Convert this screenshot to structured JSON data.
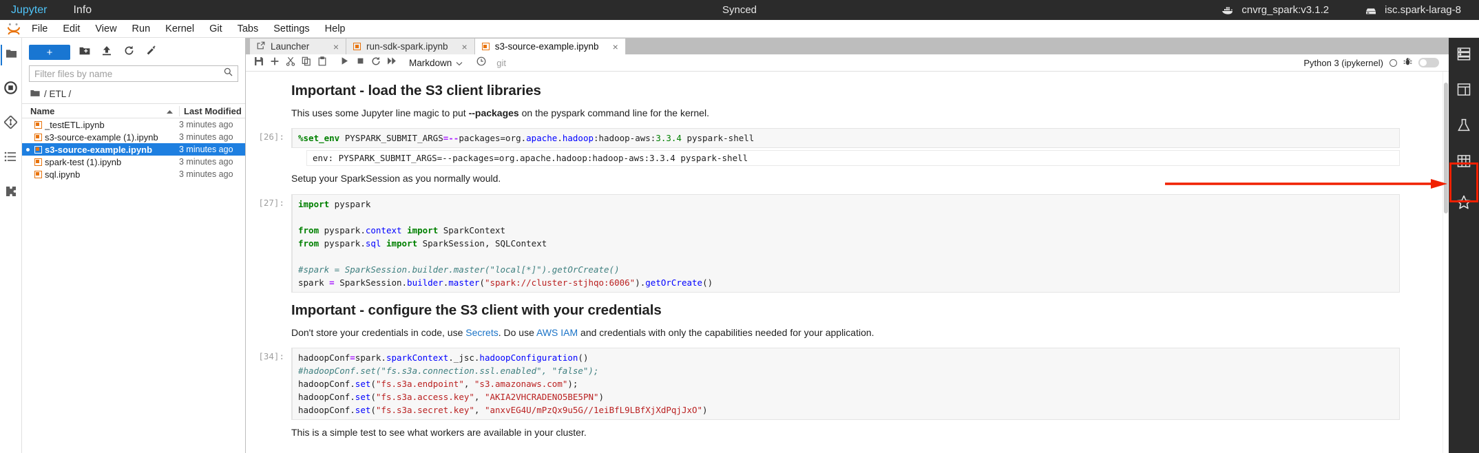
{
  "topbar": {
    "brand": "Jupyter",
    "info": "Info",
    "status": "Synced",
    "docker_icon": "docker-whale-icon",
    "docker_label": "cnvrg_spark:v3.1.2",
    "server_icon": "server-icon",
    "server_label": "isc.spark-larag-8",
    "accent": "#4fc3f7",
    "bg": "#2b2b2b"
  },
  "menubar": {
    "logo": "jupyter-logo",
    "items": [
      "File",
      "Edit",
      "View",
      "Run",
      "Kernel",
      "Git",
      "Tabs",
      "Settings",
      "Help"
    ]
  },
  "left_rail": {
    "items": [
      {
        "icon": "folder-icon",
        "name": "file-browser"
      },
      {
        "icon": "running-terminals-icon",
        "name": "running"
      },
      {
        "icon": "git-icon",
        "name": "git-panel"
      },
      {
        "icon": "table-of-contents-icon",
        "name": "toc"
      },
      {
        "icon": "extensions-puzzle-icon",
        "name": "extensions"
      }
    ]
  },
  "filebrowser": {
    "new_button": "+",
    "toolbar_icons": [
      "new-folder-icon",
      "upload-icon",
      "refresh-icon",
      "new-launcher-icon"
    ],
    "filter_placeholder": "Filter files by name",
    "filter_value": "",
    "search_icon": "search-icon",
    "breadcrumb": "/ ETL /",
    "breadcrumb_icon": "folder-icon",
    "columns": {
      "name": "Name",
      "modified": "Last Modified"
    },
    "sort_icon": "sort-ascending-icon",
    "files": [
      {
        "name": "_testETL.ipynb",
        "modified": "3 minutes ago",
        "selected": false,
        "icon": "notebook-icon"
      },
      {
        "name": "s3-source-example (1).ipynb",
        "modified": "3 minutes ago",
        "selected": false,
        "icon": "notebook-icon"
      },
      {
        "name": "s3-source-example.ipynb",
        "modified": "3 minutes ago",
        "selected": true,
        "icon": "notebook-icon"
      },
      {
        "name": "spark-test (1).ipynb",
        "modified": "3 minutes ago",
        "selected": false,
        "icon": "notebook-icon"
      },
      {
        "name": "sql.ipynb",
        "modified": "3 minutes ago",
        "selected": false,
        "icon": "notebook-icon"
      }
    ],
    "selection_color": "#1e7fe0"
  },
  "tabs": [
    {
      "label": "Launcher",
      "icon": "launcher-icon",
      "active": false,
      "close": "×"
    },
    {
      "label": "run-sdk-spark.ipynb",
      "icon": "notebook-icon",
      "active": false,
      "close": "×"
    },
    {
      "label": "s3-source-example.ipynb",
      "icon": "notebook-icon",
      "active": true,
      "close": "×"
    }
  ],
  "notebook_toolbar": {
    "buttons": [
      "save-icon",
      "insert-cell-icon",
      "cut-icon",
      "copy-icon",
      "paste-icon",
      "run-icon",
      "stop-icon",
      "restart-kernel-icon",
      "restart-run-all-icon"
    ],
    "cell_type": "Markdown",
    "cell_type_caret": "chevron-down-icon",
    "history_icon": "clock-icon",
    "git_label": "git",
    "kernel_name": "Python 3 (ipykernel)",
    "kernel_status_icon": "kernel-idle-circle-icon",
    "debug_icon": "bug-icon",
    "debug_toggle": "debugger-toggle"
  },
  "notebook": {
    "cells": [
      {
        "type": "markdown",
        "prompt": "",
        "heading": "Important - load the S3 client libraries",
        "paragraph_pre": "This uses some Jupyter line magic to put ",
        "paragraph_bold": "--packages",
        "paragraph_post": " on the pyspark command line for the kernel."
      },
      {
        "type": "code",
        "prompt": "[26]:",
        "source": "%set_env PYSPARK_SUBMIT_ARGS=--packages=org.apache.hadoop:hadoop-aws:3.3.4 pyspark-shell",
        "output": "env: PYSPARK_SUBMIT_ARGS=--packages=org.apache.hadoop:hadoop-aws:3.3.4 pyspark-shell"
      },
      {
        "type": "markdown",
        "prompt": "",
        "paragraph": "Setup your SparkSession as you normally would."
      },
      {
        "type": "code",
        "prompt": "[27]:",
        "lines": [
          "import pyspark",
          "",
          "from pyspark.context import SparkContext",
          "from pyspark.sql import SparkSession, SQLContext",
          "",
          "#spark = SparkSession.builder.master(\"local[*]\").getOrCreate()",
          "spark = SparkSession.builder.master(\"spark://cluster-stjhqo:6006\").getOrCreate()"
        ]
      },
      {
        "type": "markdown",
        "prompt": "",
        "heading": "Important - configure the S3 client with your credentials",
        "p1": "Don't store your credentials in code, use ",
        "link1": "Secrets",
        "p2": ". Do use ",
        "link2": "AWS IAM",
        "p3": " and credentials with only the capabilities needed for your application."
      },
      {
        "type": "code",
        "prompt": "[34]:",
        "lines": [
          "hadoopConf=spark.sparkContext._jsc.hadoopConfiguration()",
          "#hadoopConf.set(\"fs.s3a.connection.ssl.enabled\", \"false\");",
          "hadoopConf.set(\"fs.s3a.endpoint\", \"s3.amazonaws.com\");",
          "hadoopConf.set(\"fs.s3a.access.key\", \"AKIA2VHCRADENO5BE5PN\")",
          "hadoopConf.set(\"fs.s3a.secret.key\", \"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\")"
        ]
      },
      {
        "type": "markdown",
        "prompt": "",
        "paragraph": "This is a simple test to see what workers are available in your cluster."
      }
    ]
  },
  "right_rail": {
    "items": [
      {
        "icon": "server-stack-icon",
        "name": "compute-panel"
      },
      {
        "icon": "notes-panel-icon",
        "name": "notes-panel"
      },
      {
        "icon": "flask-icon",
        "name": "experiments-panel"
      },
      {
        "icon": "grid-icon",
        "name": "datasets-panel"
      },
      {
        "icon": "star-icon",
        "name": "favorites-panel"
      }
    ],
    "bg": "#2b2b2b"
  },
  "annotation": {
    "highlight_color": "#f02000",
    "arrow": "red-arrow-pointing-right",
    "target": "star-icon"
  }
}
